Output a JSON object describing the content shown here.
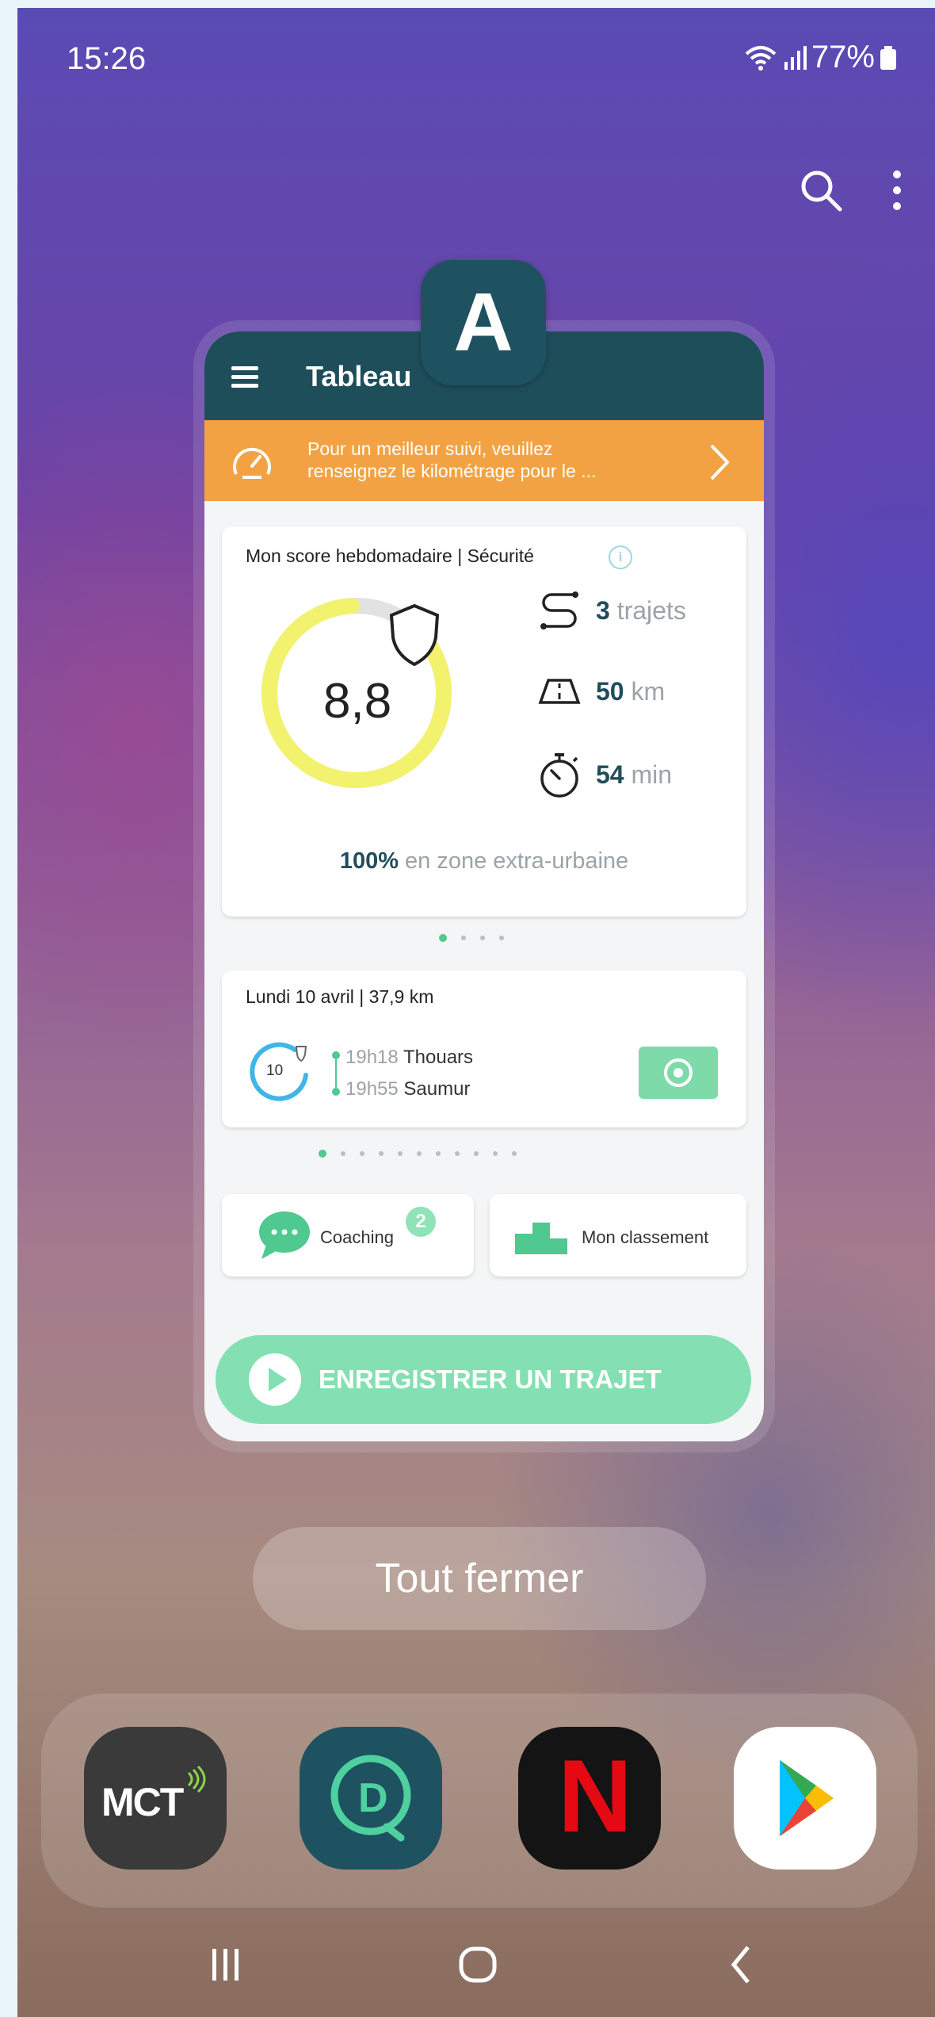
{
  "status_bar": {
    "time": "15:26",
    "battery": "77%"
  },
  "recents": {
    "close_all_label": "Tout fermer",
    "app_badge_letter": "A"
  },
  "app": {
    "header_title": "Tableau",
    "banner": {
      "line1": "Pour un meilleur suivi, veuillez",
      "line2": "renseignez le kilométrage pour le ..."
    },
    "score_card": {
      "heading": "Mon score hebdomadaire | Sécurité",
      "info_glyph": "i",
      "score": "8,8",
      "score_fraction": 0.88,
      "trips_value": "3",
      "trips_unit": "trajets",
      "km_value": "50",
      "km_unit": "km",
      "min_value": "54",
      "min_unit": "min",
      "zone_percent": "100%",
      "zone_text": "en zone extra-urbaine"
    },
    "trip_card": {
      "heading": "Lundi 10 avril | 37,9 km",
      "mini_score": "10",
      "start_time": "19h18",
      "start_place": "Thouars",
      "end_time": "19h55",
      "end_place": "Saumur"
    },
    "coaching_label": "Coaching",
    "coaching_badge": "2",
    "ranking_label": "Mon classement",
    "record_label": "ENREGISTRER UN TRAJET",
    "accent_color": "#84e0b2",
    "header_color": "#1f4e5b",
    "banner_color": "#f3a243"
  },
  "dock": {
    "apps": [
      "MCT",
      "D",
      "N",
      "Play Store"
    ]
  }
}
